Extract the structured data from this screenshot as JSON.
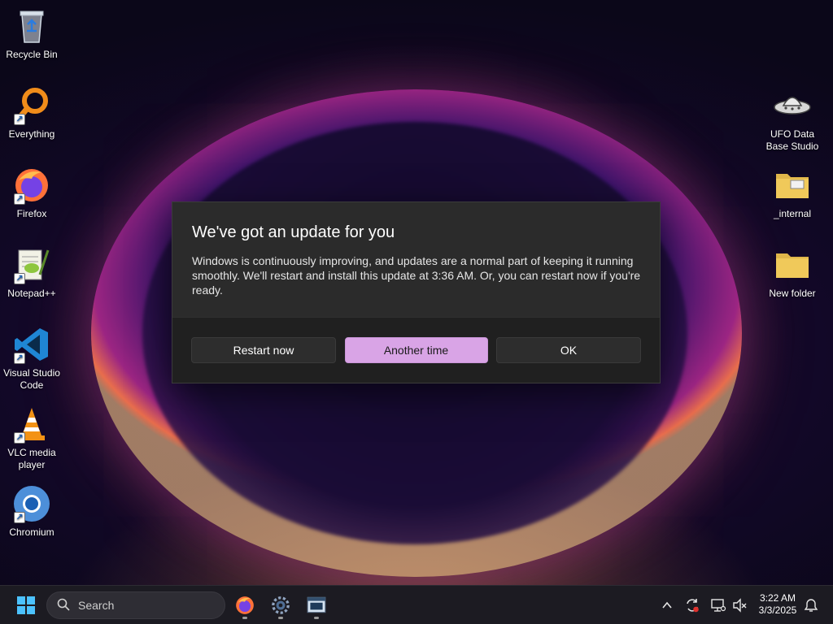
{
  "desktop": {
    "left_icons": [
      {
        "label": "Recycle Bin",
        "icon": "recycle-bin-icon"
      },
      {
        "label": "Everything",
        "icon": "everything-search-icon"
      },
      {
        "label": "Firefox",
        "icon": "firefox-icon"
      },
      {
        "label": "Notepad++",
        "icon": "notepad-plus-plus-icon"
      },
      {
        "label": "Visual Studio Code",
        "icon": "vscode-icon"
      },
      {
        "label": "VLC media player",
        "icon": "vlc-icon"
      },
      {
        "label": "Chromium",
        "icon": "chromium-icon"
      }
    ],
    "right_icons": [
      {
        "label": "UFO Data Base Studio",
        "icon": "ufo-icon"
      },
      {
        "label": "_internal",
        "icon": "folder-icon"
      },
      {
        "label": "New folder",
        "icon": "folder-icon"
      }
    ]
  },
  "dialog": {
    "title": "We've got an update for you",
    "message": "Windows is continuously improving, and updates are a normal part of keeping it running smoothly. We'll restart and install this update at 3:36 AM. Or, you can restart now if you're ready.",
    "buttons": {
      "restart": "Restart now",
      "another_time": "Another time",
      "ok": "OK"
    },
    "accent_color": "#d9a4e6"
  },
  "taskbar": {
    "search_placeholder": "Search",
    "pinned": [
      "firefox-icon",
      "settings-gear-icon",
      "terminal-window-icon"
    ],
    "tray_icons": [
      "chevron-up-icon",
      "update-sync-icon",
      "network-icon",
      "volume-muted-icon",
      "notifications-icon"
    ],
    "time": "3:22 AM",
    "date": "3/3/2025"
  }
}
